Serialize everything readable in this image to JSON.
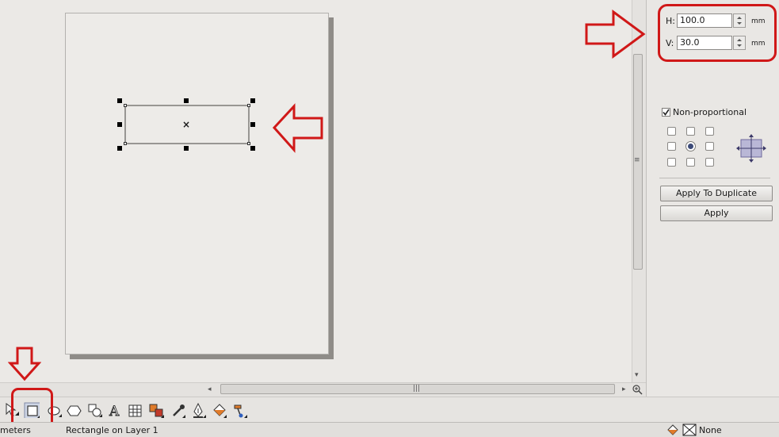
{
  "docker": {
    "h_label": "H:",
    "h_value": "100.0",
    "v_label": "V:",
    "v_value": "30.0",
    "unit_h": "mm",
    "unit_v": "mm",
    "non_proportional_label": "Non-proportional",
    "non_proportional_checked": true,
    "anchor_selected": "center",
    "apply_to_duplicate_label": "Apply To Duplicate",
    "apply_label": "Apply"
  },
  "status": {
    "units_text": "meters",
    "object_info": "Rectangle on Layer 1",
    "fill_label": "None"
  },
  "toolbox": {
    "tools": [
      "pick-tool",
      "rectangle-tool",
      "ellipse-tool",
      "polygon-tool",
      "basic-shapes-tool",
      "text-tool",
      "table-tool",
      "interactive-blend-tool",
      "eyedropper-tool",
      "outline-pen-tool",
      "fill-tool",
      "interactive-fill-tool"
    ],
    "active_tool": "rectangle-tool"
  },
  "annotations": {
    "color": "#d01818",
    "arrows": [
      "right-arrow-to-size-fields",
      "left-arrow-to-rectangle",
      "down-arrow-to-rectangle-tool"
    ],
    "highlights": [
      "size-fields-oval",
      "rectangle-tool-box"
    ]
  },
  "colors": {
    "canvas": "#ebe9e6",
    "page": "#edebe8",
    "page_shadow": "#8f8c88",
    "annotation_red": "#d01818"
  }
}
